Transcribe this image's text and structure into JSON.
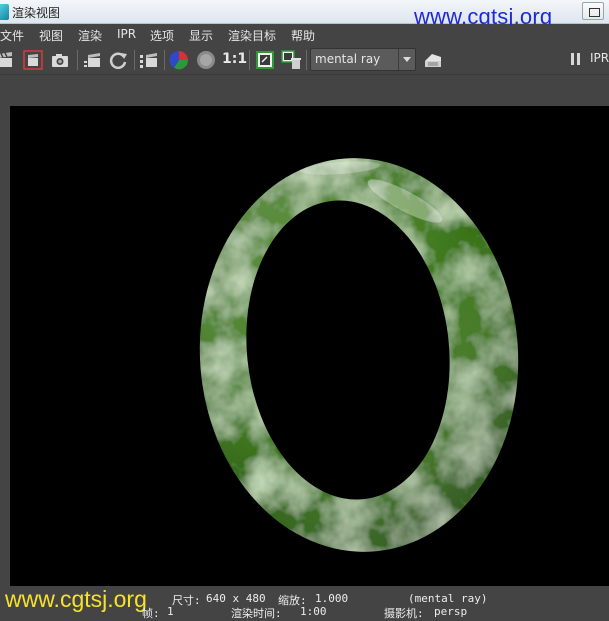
{
  "window": {
    "title": "渲染视图",
    "icon": "maya-app-icon"
  },
  "watermarks": {
    "top": "www.cgtsj.org",
    "bottom": "www.cgtsj.org"
  },
  "menu": {
    "items": [
      "文件",
      "视图",
      "渲染",
      "IPR",
      "选项",
      "显示",
      "渲染目标",
      "帮助"
    ]
  },
  "toolbar": {
    "ratio_label": "1:1",
    "renderer": "mental ray",
    "ipr_label": "IPR",
    "icons": [
      "clapper-icon",
      "render-region-icon",
      "snapshot-icon",
      "render-sequence-icon",
      "refresh-icon",
      "ipr-region-icon",
      "rgb-channels-icon",
      "alpha-channel-icon",
      "keep-image-icon",
      "remove-image-icon",
      "render-settings-icon",
      "pause-icon"
    ]
  },
  "status": {
    "size_label": "尺寸:",
    "size_value": "640 x 480",
    "zoom_label": "缩放:",
    "zoom_value": "1.000",
    "renderer_info": "(mental ray)",
    "frame_label": "帧:",
    "frame_value": "1",
    "time_label": "渲染时间:",
    "time_value": "1:00",
    "camera_label": "摄影机:",
    "camera_value": "persp"
  },
  "colors": {
    "background": "#444444",
    "viewport": "#000000",
    "jade_dark": "#2f6a14",
    "jade_light": "#a8c78d",
    "watermark_top": "#1d2ad8",
    "watermark_bottom": "#f7e22a"
  }
}
